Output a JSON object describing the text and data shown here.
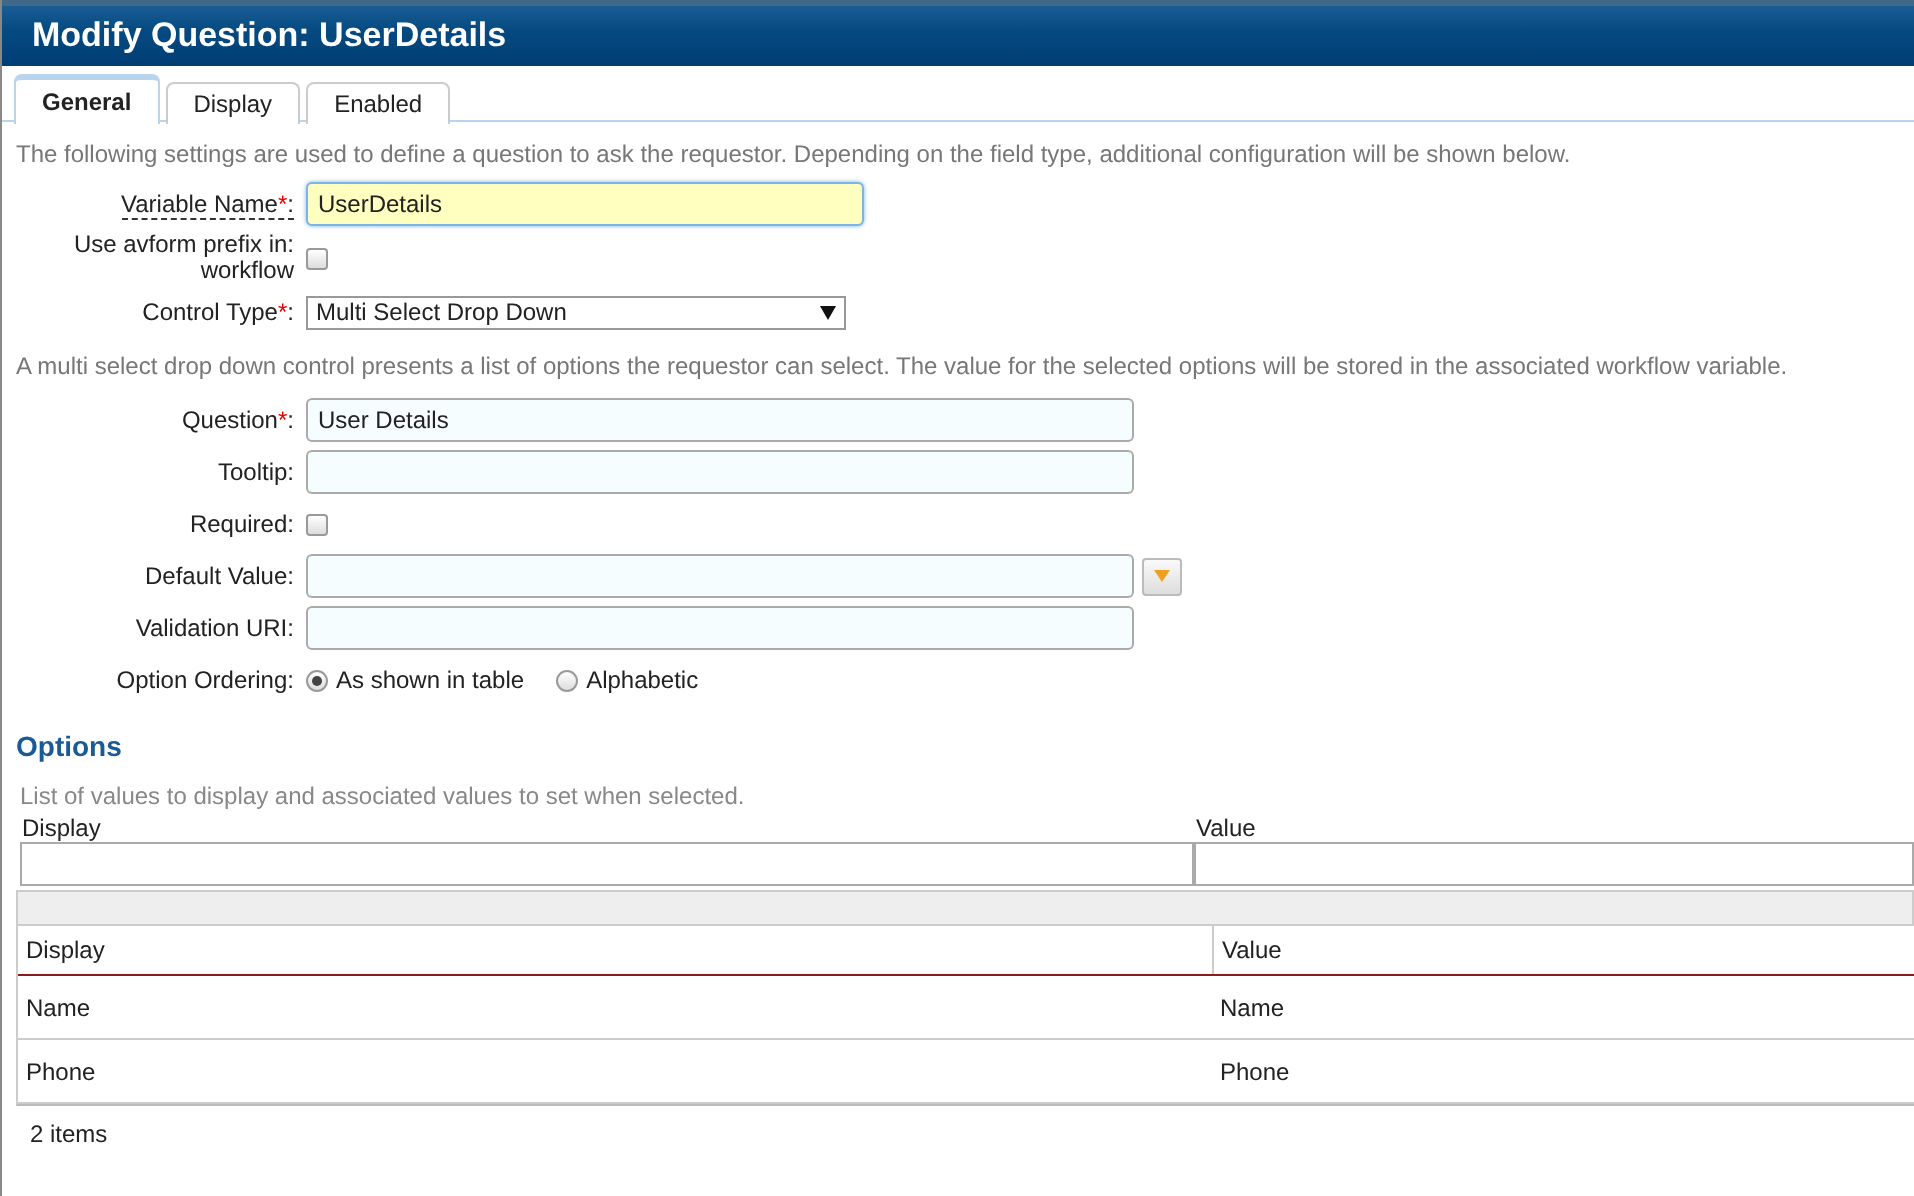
{
  "window": {
    "title": "Modify Question: UserDetails"
  },
  "tabs": [
    {
      "label": "General",
      "selected": true
    },
    {
      "label": "Display",
      "selected": false
    },
    {
      "label": "Enabled",
      "selected": false
    }
  ],
  "intro": "The following settings are used to define a question to ask the requestor. Depending on the field type, additional configuration will be shown below.",
  "fields_top": [
    {
      "kind": "text",
      "label": "Variable Name",
      "required_mark": "*",
      "colon": ":",
      "underlined": true,
      "value": "UserDetails",
      "focused": true
    },
    {
      "kind": "checkbox",
      "label": "Use avform prefix in:",
      "colon": "workflow",
      "underlined": false,
      "checked": false
    },
    {
      "kind": "select",
      "label": "Control Type",
      "required_mark": "*",
      "colon": ":",
      "underlined": false,
      "value": "Multi Select Drop Down"
    }
  ],
  "description": "A multi select drop down control presents a list of options the requestor can select. The value for the selected options will be stored in the associated workflow variable.",
  "fields": [
    {
      "kind": "text",
      "label": "Question",
      "required_mark": "*",
      "colon": ":",
      "underlined": false,
      "value": "User Details",
      "focused": false
    },
    {
      "kind": "text",
      "label": "Tooltip",
      "colon": ":",
      "underlined": false,
      "focused": false
    },
    {
      "kind": "checkbox",
      "label": "Required",
      "colon": ":",
      "underlined": false,
      "checked": false
    },
    {
      "kind": "lookup",
      "label": "Default Value",
      "colon": ":",
      "underlined": false
    },
    {
      "kind": "text",
      "label": "Validation URI",
      "colon": ":",
      "underlined": false,
      "focused": false
    },
    {
      "kind": "radio",
      "label": "Option Ordering",
      "colon": ":",
      "underlined": false,
      "options": [
        {
          "label": "As shown in table",
          "selected": true
        },
        {
          "label": "Alphabetic",
          "selected": false
        }
      ]
    }
  ],
  "options": {
    "heading": "Options",
    "hint": "List of values to display and associated values to set when selected.",
    "filter_labels": [
      "Display",
      "Value"
    ],
    "columns": [
      "Display",
      "Value"
    ],
    "rows": [
      [
        "Name",
        "Name"
      ],
      [
        "Phone",
        "Phone"
      ]
    ],
    "footer": "2 items"
  }
}
